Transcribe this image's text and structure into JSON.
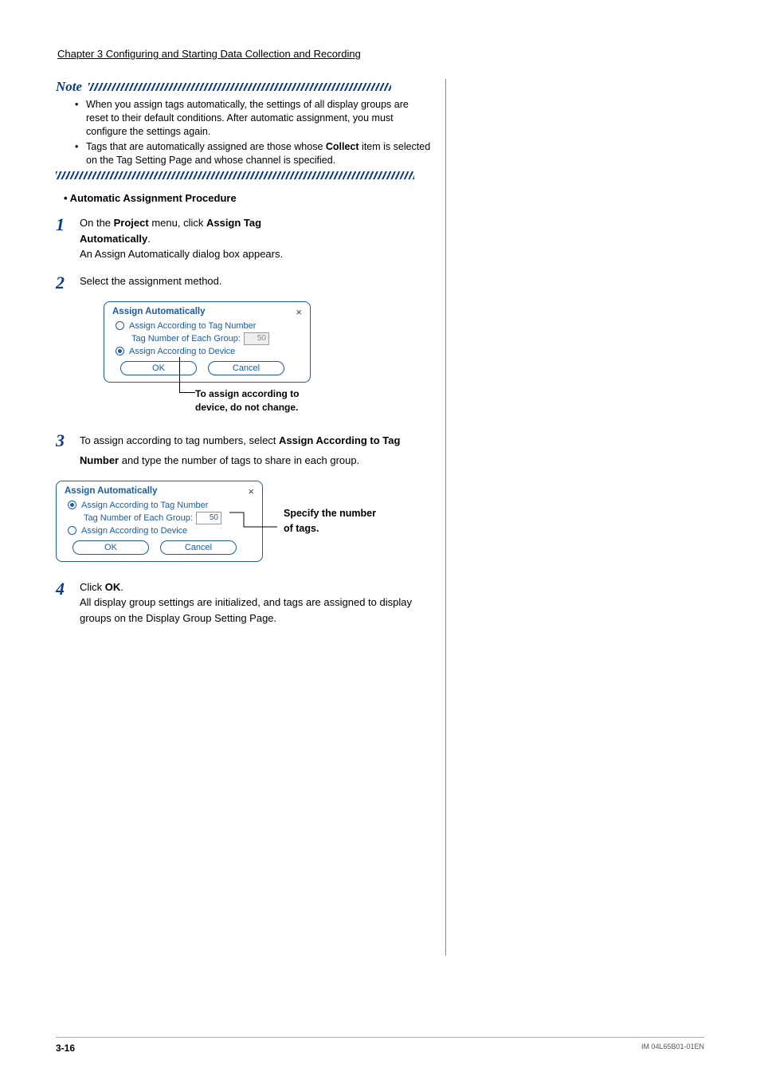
{
  "chapter_header": "Chapter 3  Configuring and Starting Data Collection and Recording",
  "note": {
    "label": "Note",
    "items": [
      {
        "pre": "When you assign tags automatically, the settings of all display groups are reset to their default conditions. After automatic assignment, you must configure the settings again."
      },
      {
        "pre": "Tags that are automatically assigned are those whose ",
        "bold": "Collect",
        "post": " item is selected on the Tag Setting Page and whose channel is specified."
      }
    ]
  },
  "subhead": "•  Automatic Assignment Procedure",
  "steps": {
    "s1": {
      "num": "1",
      "line1_a": "On the ",
      "line1_b": "Project",
      "line1_c": " menu, click ",
      "line1_d": "Assign Tag",
      "line2_bold": "Automatically",
      "line2_post": ".",
      "line3": "An Assign Automatically dialog box appears."
    },
    "s2": {
      "num": "2",
      "text": "Select the assignment method."
    },
    "s3": {
      "num": "3",
      "a": "To assign according to tag numbers, select ",
      "b": "Assign According to Tag Number",
      "c": " and type the number of tags to share in each group."
    },
    "s4": {
      "num": "4",
      "a": "Click ",
      "b": "OK",
      "c": ".",
      "rest": "All display group settings are initialized, and tags are assigned to display groups on the Display Group Setting Page."
    }
  },
  "dialog": {
    "title": "Assign Automatically",
    "close": "×",
    "radio_tag": "Assign According to Tag Number",
    "tag_each_label": "Tag Number of Each Group:",
    "tag_each_value": "50",
    "radio_device": "Assign According to Device",
    "ok": "OK",
    "cancel": "Cancel"
  },
  "caption1_l1": "To assign according to",
  "caption1_l2": "device, do not change.",
  "callout2_l1": "Specify the number",
  "callout2_l2": "of tags.",
  "footer": {
    "page": "3-16",
    "doc": "IM 04L65B01-01EN"
  }
}
